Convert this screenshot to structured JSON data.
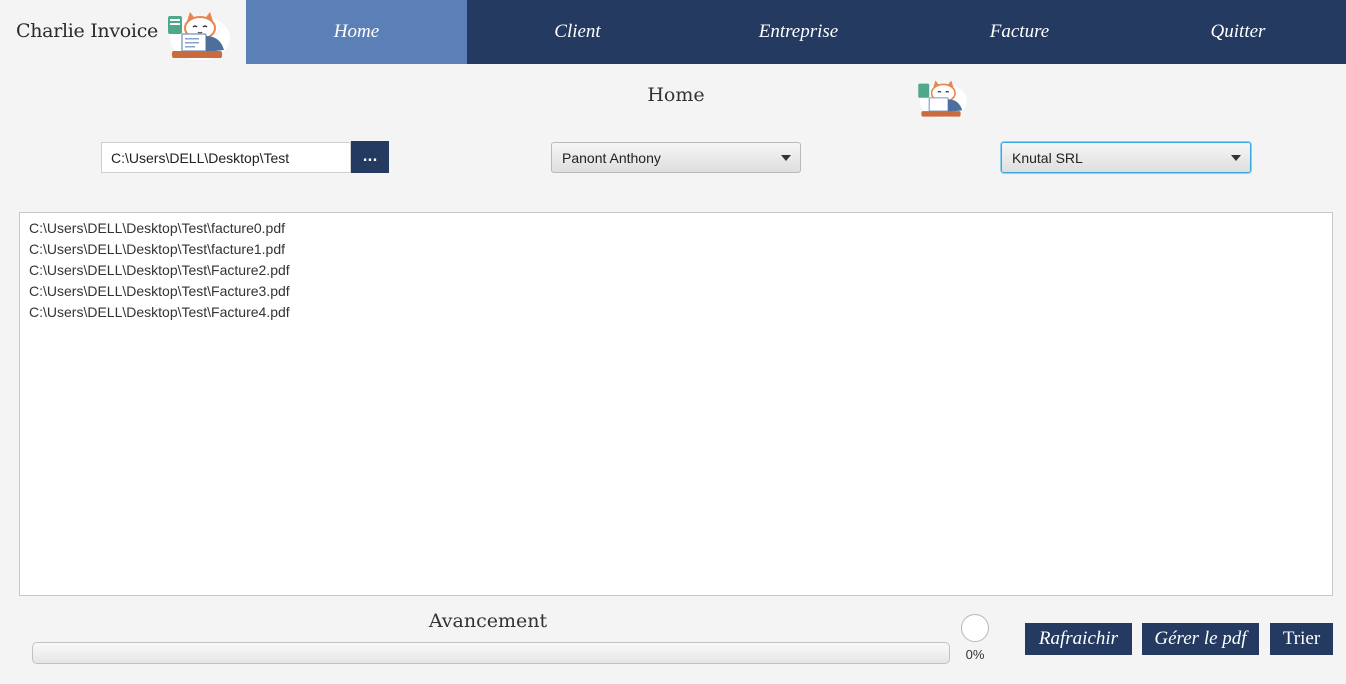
{
  "app": {
    "title": "Charlie Invoice"
  },
  "nav": {
    "items": [
      {
        "label": "Home",
        "active": true
      },
      {
        "label": "Client",
        "active": false
      },
      {
        "label": "Entreprise",
        "active": false
      },
      {
        "label": "Facture",
        "active": false
      },
      {
        "label": "Quitter",
        "active": false
      }
    ]
  },
  "page": {
    "title": "Home"
  },
  "controls": {
    "folder_path": "C:\\Users\\DELL\\Desktop\\Test",
    "browse_label": "...",
    "client_selected": "Panont Anthony",
    "company_selected": "Knutal SRL"
  },
  "files": [
    "C:\\Users\\DELL\\Desktop\\Test\\facture0.pdf",
    "C:\\Users\\DELL\\Desktop\\Test\\facture1.pdf",
    "C:\\Users\\DELL\\Desktop\\Test\\Facture2.pdf",
    "C:\\Users\\DELL\\Desktop\\Test\\Facture3.pdf",
    "C:\\Users\\DELL\\Desktop\\Test\\Facture4.pdf"
  ],
  "progress": {
    "label": "Avancement",
    "value": 0,
    "percent_text": "0%"
  },
  "actions": {
    "refresh_label": "Rafraichir",
    "manage_pdf_label": "Gérer le pdf",
    "sort_label": "Trier"
  },
  "colors": {
    "primary": "#243a60",
    "nav_active": "#5b80b8",
    "background": "#f4f4f4",
    "focus": "#3ba7e0"
  },
  "icons": {
    "logo": "cat-mascot-icon",
    "spinner": "progress-indicator-icon",
    "dropdown": "chevron-down-icon"
  }
}
